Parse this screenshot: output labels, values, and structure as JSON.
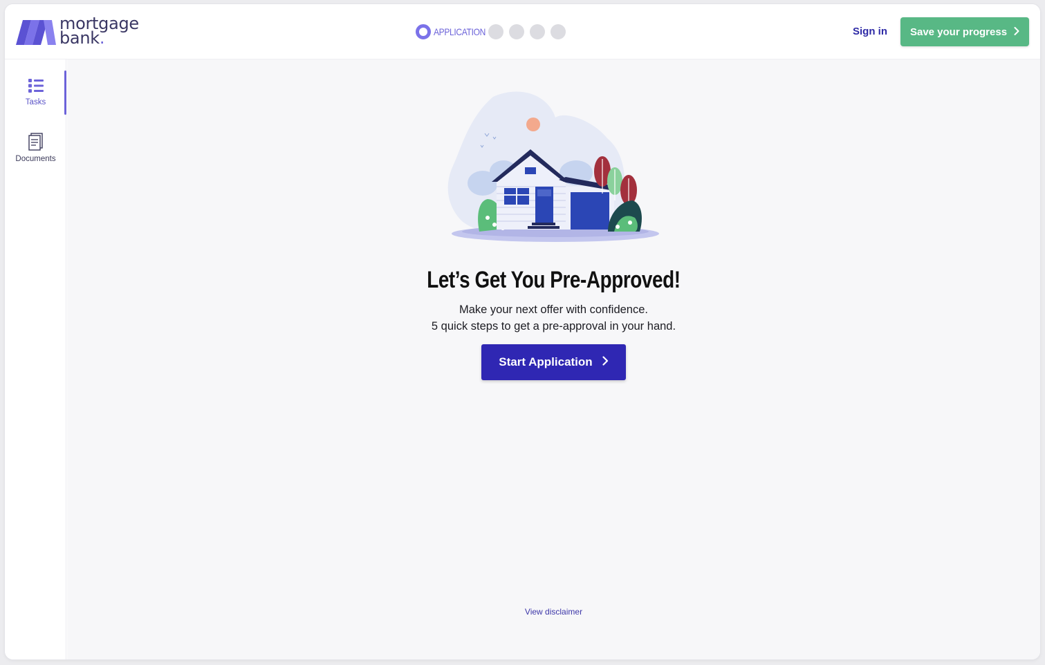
{
  "header": {
    "logo": {
      "line1": "mortgage",
      "line2": "bank",
      "dot": "."
    },
    "stepper": {
      "current_label": "APPLICATION",
      "remaining_steps": 4
    },
    "signin_label": "Sign in",
    "save_label": "Save your progress"
  },
  "sidebar": {
    "items": [
      {
        "label": "Tasks",
        "icon": "list-icon",
        "active": true
      },
      {
        "label": "Documents",
        "icon": "document-icon",
        "active": false
      }
    ]
  },
  "main": {
    "title": "Let’s Get You Pre-Approved!",
    "subtitle_line1": "Make your next offer with confidence.",
    "subtitle_line2": "5 quick steps to get a pre-approval in your hand.",
    "start_label": "Start Application",
    "disclaimer_label": "View disclaimer"
  },
  "colors": {
    "brand": "#6c63d9",
    "primary_button": "#2f27b3",
    "save_button": "#58b885",
    "link": "#2e2aa6"
  }
}
